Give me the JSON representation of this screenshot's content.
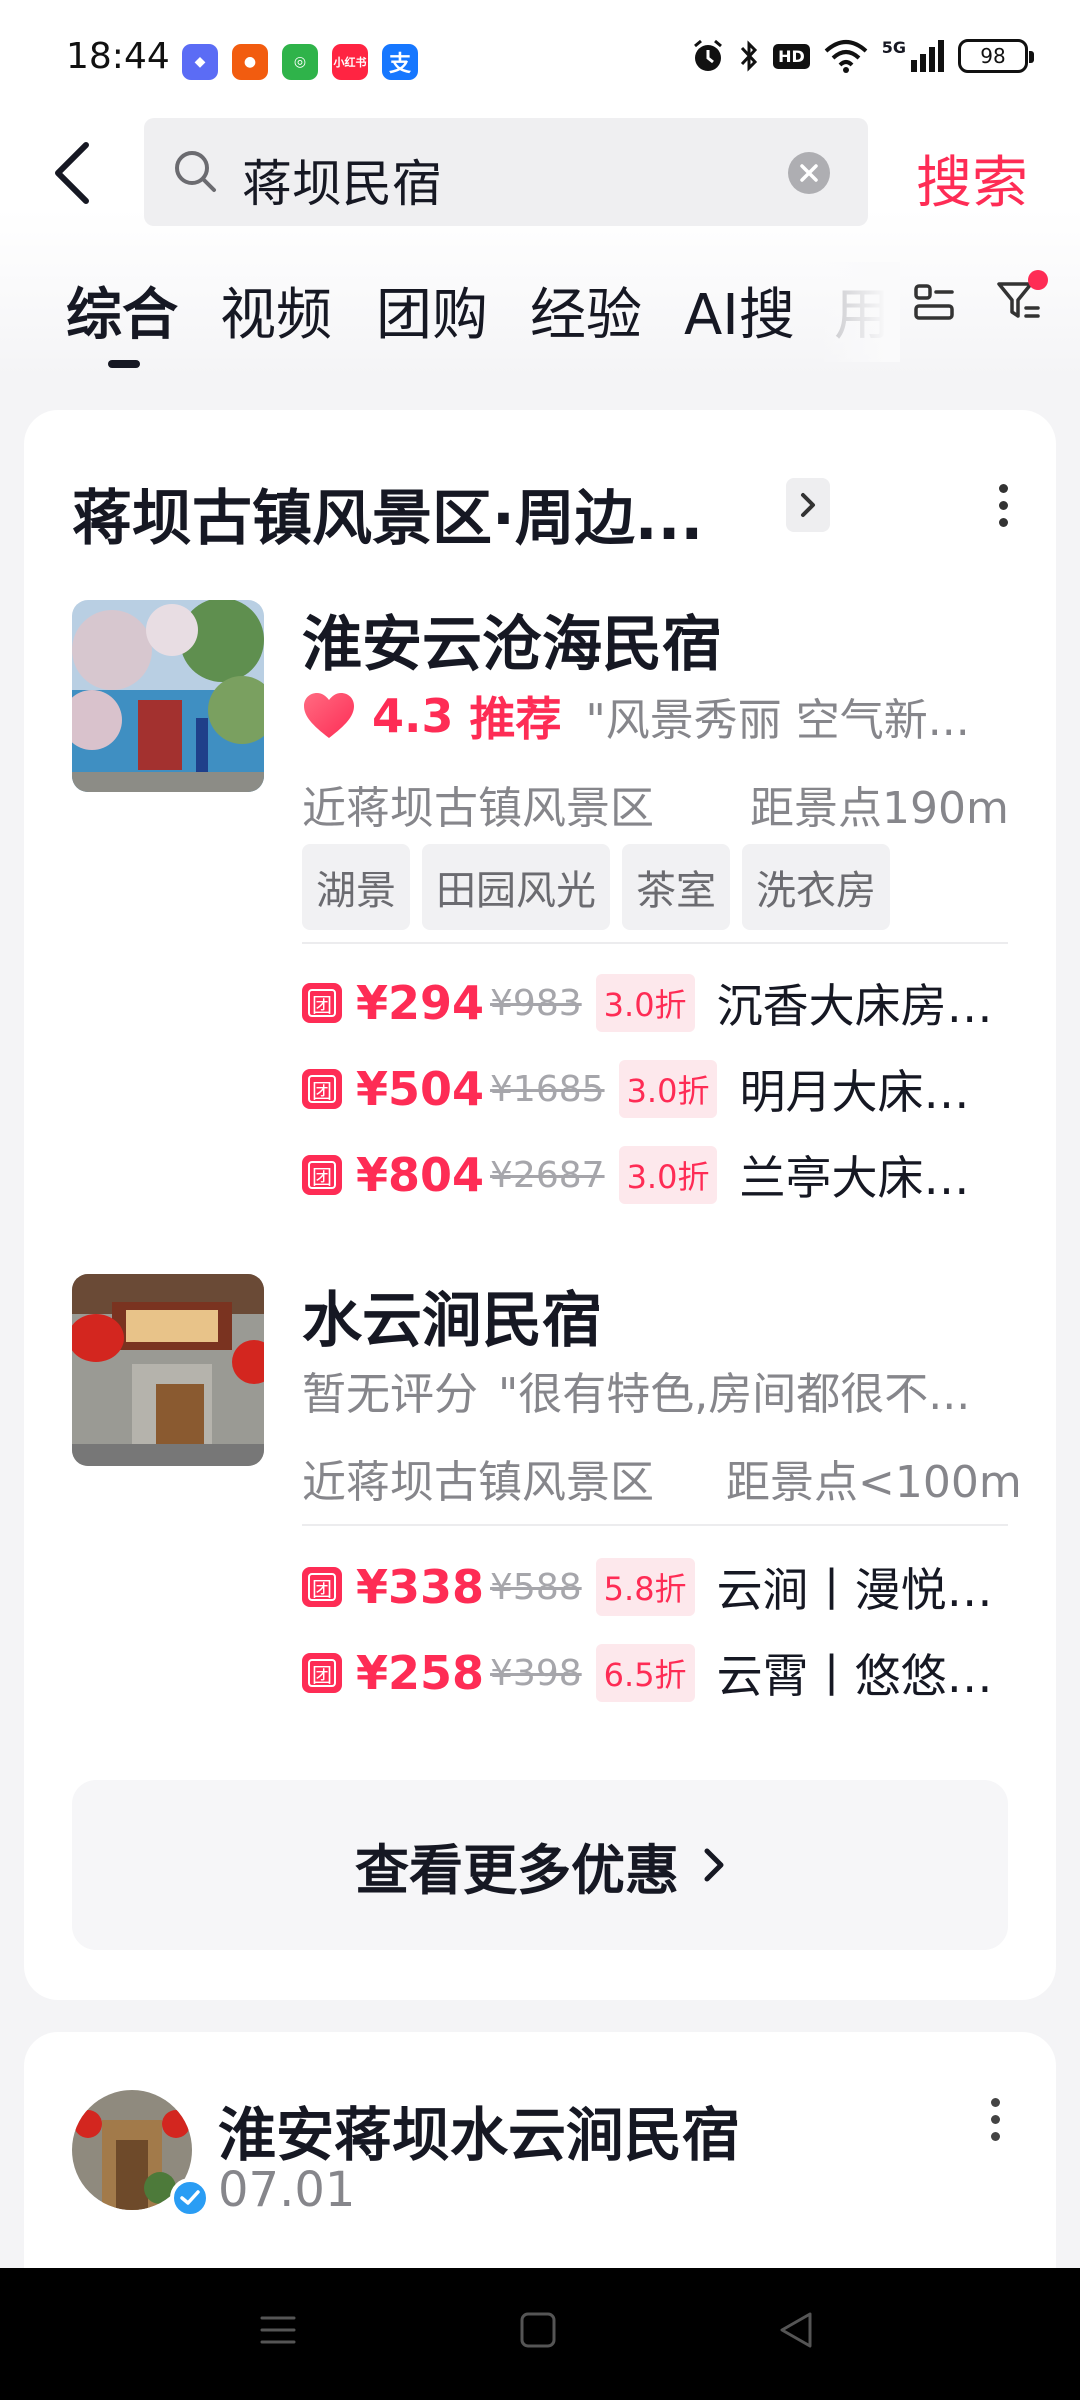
{
  "status_bar": {
    "time": "18:44",
    "app_icons": [
      {
        "name": "app-icon-1",
        "glyph": "◆",
        "color": "#5b6cf5"
      },
      {
        "name": "app-icon-2",
        "glyph": "●",
        "color": "#f25c0f"
      },
      {
        "name": "app-icon-3",
        "glyph": "◎",
        "color": "#2fb34a"
      },
      {
        "name": "app-icon-4",
        "glyph": "小红书",
        "color": "#ff2442"
      },
      {
        "name": "alipay-icon",
        "glyph": "支",
        "color": "#1677ff"
      }
    ],
    "hd_label": "HD",
    "network_label": "5G",
    "battery": "98"
  },
  "search": {
    "query": "蒋坝民宿",
    "button_label": "搜索"
  },
  "tabs": [
    {
      "label": "综合",
      "active": true
    },
    {
      "label": "视频"
    },
    {
      "label": "团购"
    },
    {
      "label": "经验"
    },
    {
      "label": "AI搜"
    },
    {
      "label": "用"
    }
  ],
  "card": {
    "title": "蒋坝古镇风景区·周边...",
    "hotels": [
      {
        "name": "淮安云沧海民宿",
        "rating_score": "4.3",
        "rating_label": "推荐",
        "review": "\"风景秀丽 空气新...",
        "location": "近蒋坝古镇风景区",
        "distance": "距景点190m",
        "tags": [
          "湖景",
          "田园风光",
          "茶室",
          "洗衣房"
        ],
        "deals": [
          {
            "price": "¥294",
            "original": "¥983",
            "discount": "3.0折",
            "name": "沉香大床房+..."
          },
          {
            "price": "¥504",
            "original": "¥1685",
            "discount": "3.0折",
            "name": "明月大床房+..."
          },
          {
            "price": "¥804",
            "original": "¥2687",
            "discount": "3.0折",
            "name": "兰亭大床房+..."
          }
        ]
      },
      {
        "name": "水云涧民宿",
        "no_rating": "暂无评分",
        "review": "\"很有特色,房间都很不...",
        "location": "近蒋坝古镇风景区",
        "distance": "距景点<100m",
        "deals": [
          {
            "price": "¥338",
            "original": "¥588",
            "discount": "5.8折",
            "name": "云涧丨漫悦枕..."
          },
          {
            "price": "¥258",
            "original": "¥398",
            "discount": "6.5折",
            "name": "云霄丨悠悠榻..."
          }
        ]
      }
    ],
    "deal_icon_glyph": "团",
    "more_deals_label": "查看更多优惠"
  },
  "post": {
    "author": "淮安蒋坝水云涧民宿",
    "date": "07.01"
  },
  "colors": {
    "accent": "#fe2c55",
    "text": "#161823",
    "muted": "#86868b"
  }
}
